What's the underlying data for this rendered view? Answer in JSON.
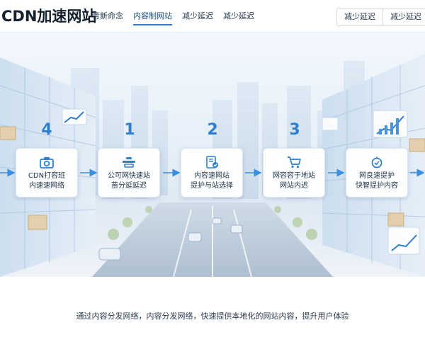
{
  "header": {
    "logo": "CDN加速网站",
    "nav": [
      "青新命念",
      "内容制网站",
      "减少延迟",
      "减少延迟"
    ],
    "active_nav_index": 1,
    "right_buttons": [
      "减少延迟",
      "减少延迟"
    ]
  },
  "hero": {
    "steps": [
      {
        "number": "4",
        "icon": "camera-icon",
        "line1": "CDN打容班",
        "line2": "内速速网络"
      },
      {
        "number": "1",
        "icon": "server-icon",
        "line1": "公可网快速站",
        "line2": "苗分延延迟"
      },
      {
        "number": "2",
        "icon": "document-shield-icon",
        "line1": "内容速网站",
        "line2": "提护与站选择"
      },
      {
        "number": "3",
        "icon": "cart-icon",
        "line1": "网容容于地站",
        "line2": "网站内迟"
      },
      {
        "number": "",
        "icon": "clock-check-icon",
        "line1": "网良速提护",
        "line2": "快智提护内容"
      }
    ],
    "colors": {
      "accent": "#2f7fd1",
      "arrow": "#3a8ee0"
    }
  },
  "tagline": "通过内容分发网络，内容分发网络，快速提供本地化的网站内容，提升用户体验"
}
